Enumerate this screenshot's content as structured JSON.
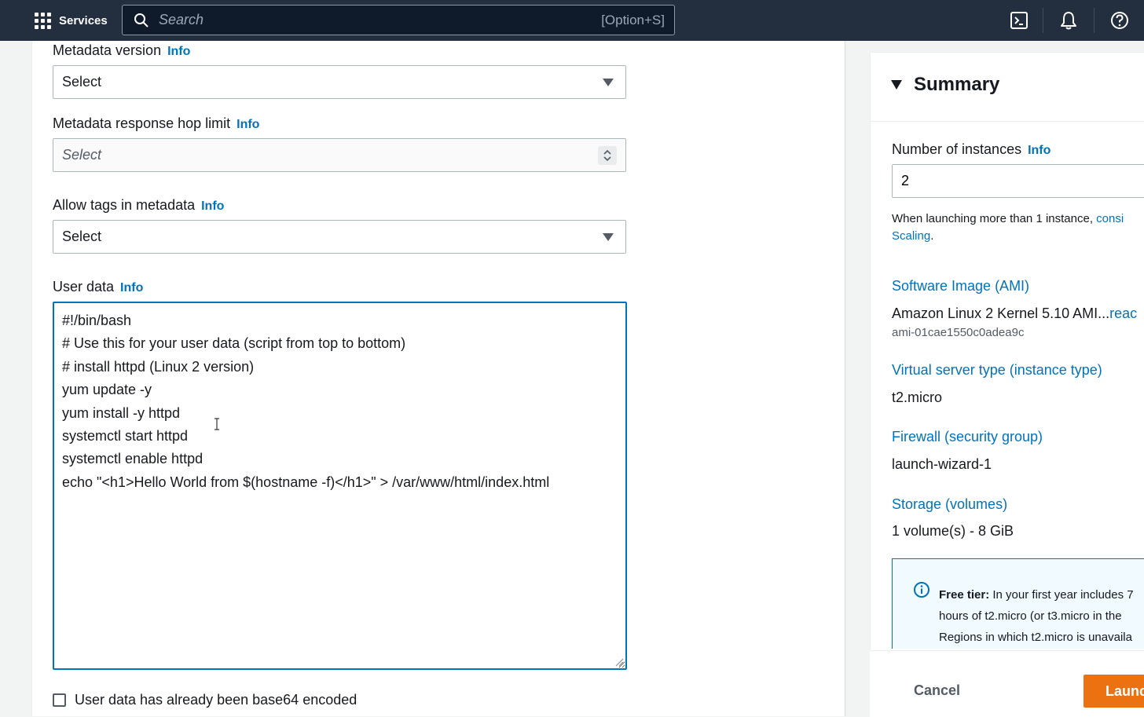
{
  "topnav": {
    "services_label": "Services",
    "search_placeholder": "Search",
    "search_shortcut": "[Option+S]",
    "icons": [
      "cloudshell-icon",
      "notifications-icon",
      "help-icon"
    ]
  },
  "form": {
    "metadata_version": {
      "label": "Metadata version",
      "info": "Info",
      "value": "Select"
    },
    "hop_limit": {
      "label": "Metadata response hop limit",
      "info": "Info",
      "placeholder": "Select"
    },
    "allow_tags": {
      "label": "Allow tags in metadata",
      "info": "Info",
      "value": "Select"
    },
    "user_data": {
      "label": "User data",
      "info": "Info",
      "lines": [
        "#!/bin/bash",
        "# Use this for your user data (script from top to bottom)",
        "# install httpd (Linux 2 version)",
        "yum update -y",
        "yum install -y httpd",
        "systemctl start httpd",
        "systemctl enable httpd",
        "echo \"<h1>Hello World from $(hostname -f)</h1>\" > /var/www/html/index.html"
      ]
    },
    "base64_checkbox_label": "User data has already been base64 encoded"
  },
  "summary": {
    "title": "Summary",
    "instances_label": "Number of instances",
    "instances_info": "Info",
    "instances_value": "2",
    "note_prefix": "When launching more than 1 instance, ",
    "note_link1": "consi",
    "note_link2": "Scaling",
    "note_suffix": ".",
    "ami_heading": "Software Image (AMI)",
    "ami_value": "Amazon Linux 2 Kernel 5.10 AMI...",
    "ami_more": "reac",
    "ami_id": "ami-01cae1550c0adea9c",
    "instance_type_heading": "Virtual server type (instance type)",
    "instance_type_value": "t2.micro",
    "firewall_heading": "Firewall (security group)",
    "firewall_value": "launch-wizard-1",
    "storage_heading": "Storage (volumes)",
    "storage_value": "1 volume(s) - 8 GiB",
    "free_tier_bold": "Free tier:",
    "free_tier_line1": " In your first year includes 7",
    "free_tier_line2": "hours of t2.micro (or t3.micro in the",
    "free_tier_line3": "Regions in which t2.micro is unavaila",
    "cancel_label": "Cancel",
    "launch_label": "Launc"
  },
  "colors": {
    "nav_bg": "#232f3e",
    "link": "#0073bb",
    "primary_button": "#ec7211",
    "focus_border": "#0073bb"
  }
}
